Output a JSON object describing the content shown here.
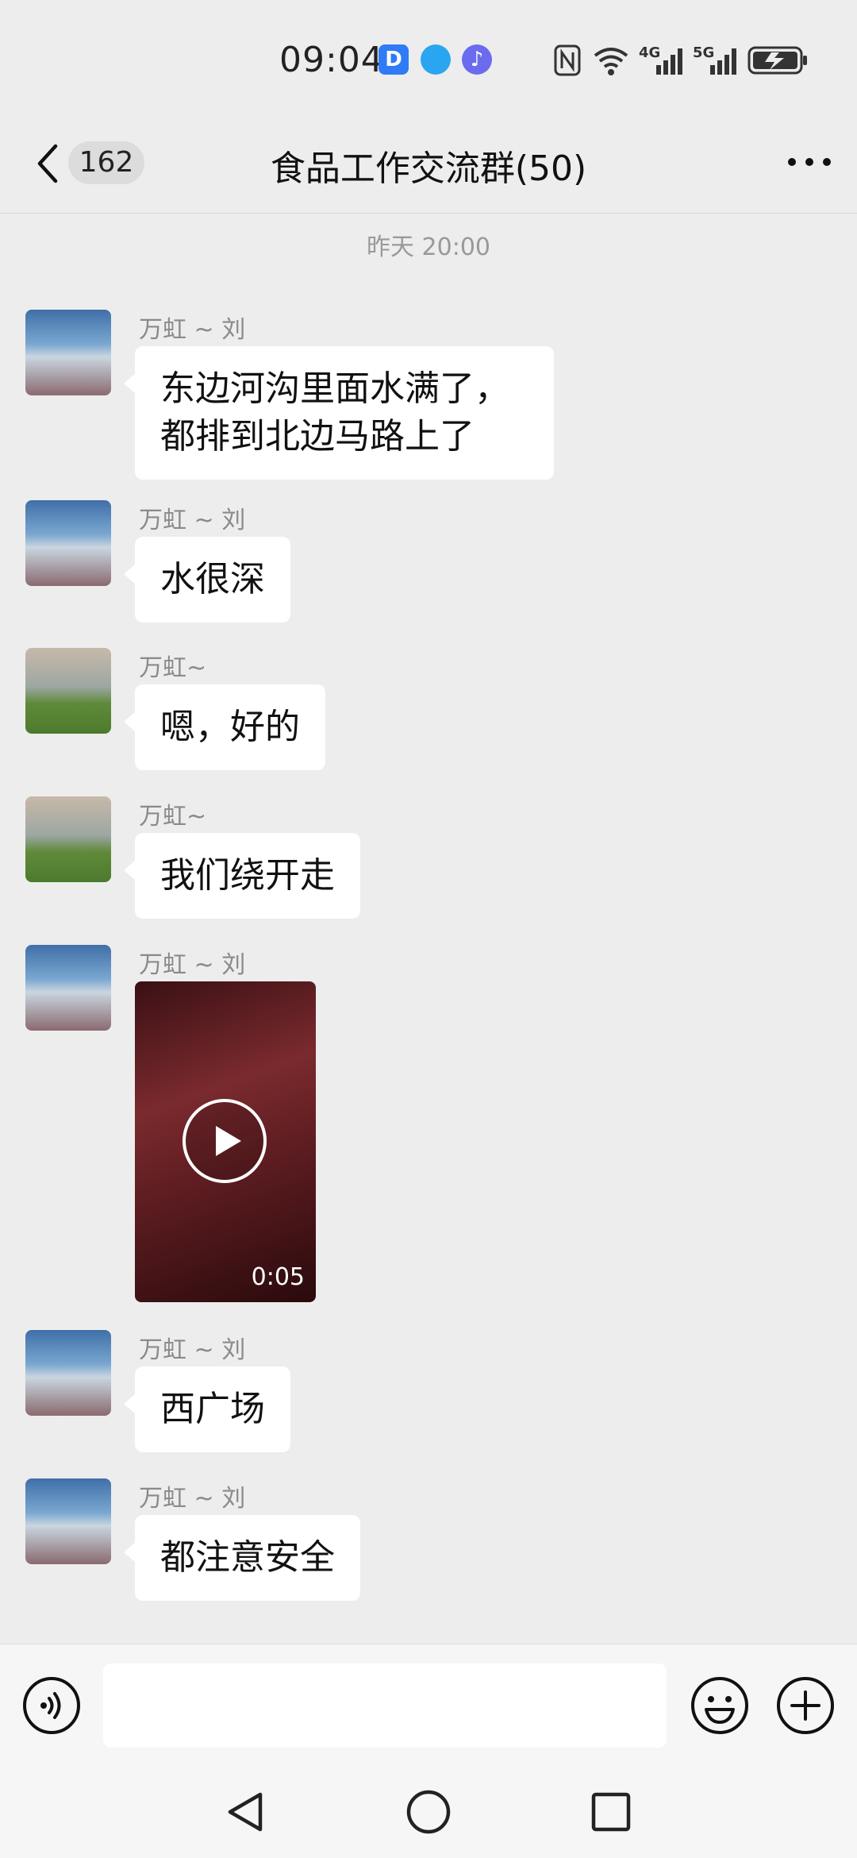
{
  "status_bar": {
    "time": "09:04",
    "icons": [
      "app-d-icon",
      "app-globe-icon",
      "app-music-icon",
      "nfc-icon",
      "wifi-icon",
      "signal-4g-icon",
      "signal-5g-icon",
      "battery-charging-icon"
    ],
    "labels": {
      "net1": "4G",
      "net2": "5G"
    }
  },
  "header": {
    "unread_count": "162",
    "title": "食品工作交流群(50)"
  },
  "timestamp": "昨天 20:00",
  "messages": [
    {
      "sender": "万虹 ~ 刘",
      "type": "text",
      "text": "东边河沟里面水满了，都排到北边马路上了"
    },
    {
      "sender": "万虹 ~ 刘",
      "type": "text",
      "text": "水很深"
    },
    {
      "sender": "万虹~",
      "type": "text",
      "text": "嗯，好的"
    },
    {
      "sender": "万虹~",
      "type": "text",
      "text": "我们绕开走"
    },
    {
      "sender": "万虹 ~ 刘",
      "type": "video",
      "duration": "0:05"
    },
    {
      "sender": "万虹 ~ 刘",
      "type": "text",
      "text": "西广场"
    },
    {
      "sender": "万虹 ~ 刘",
      "type": "text",
      "text": "都注意安全"
    }
  ],
  "input": {
    "value": "",
    "placeholder": ""
  },
  "colors": {
    "background": "#ededed",
    "bubble": "#ffffff",
    "text": "#111111",
    "meta": "#999999"
  }
}
